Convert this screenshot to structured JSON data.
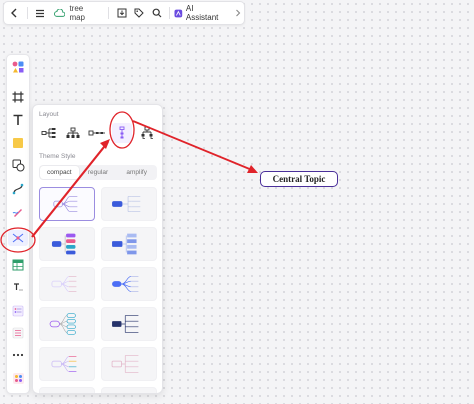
{
  "toolbar": {
    "doc_title": "tree map",
    "ai_label": "AI Assistant"
  },
  "panel": {
    "layout_label": "Layout",
    "theme_label": "Theme Style",
    "segments": [
      {
        "label": "compact",
        "active": true
      },
      {
        "label": "regular",
        "active": false
      },
      {
        "label": "amplify",
        "active": false
      }
    ]
  },
  "canvas": {
    "central_topic": "Central Topic"
  },
  "colors": {
    "accent": "#4a2f9a",
    "annotation_red": "#e0232a",
    "theme_blue": "#3b5bdb",
    "theme_purple": "#9b59f0",
    "theme_teal": "#2aa6c9"
  }
}
